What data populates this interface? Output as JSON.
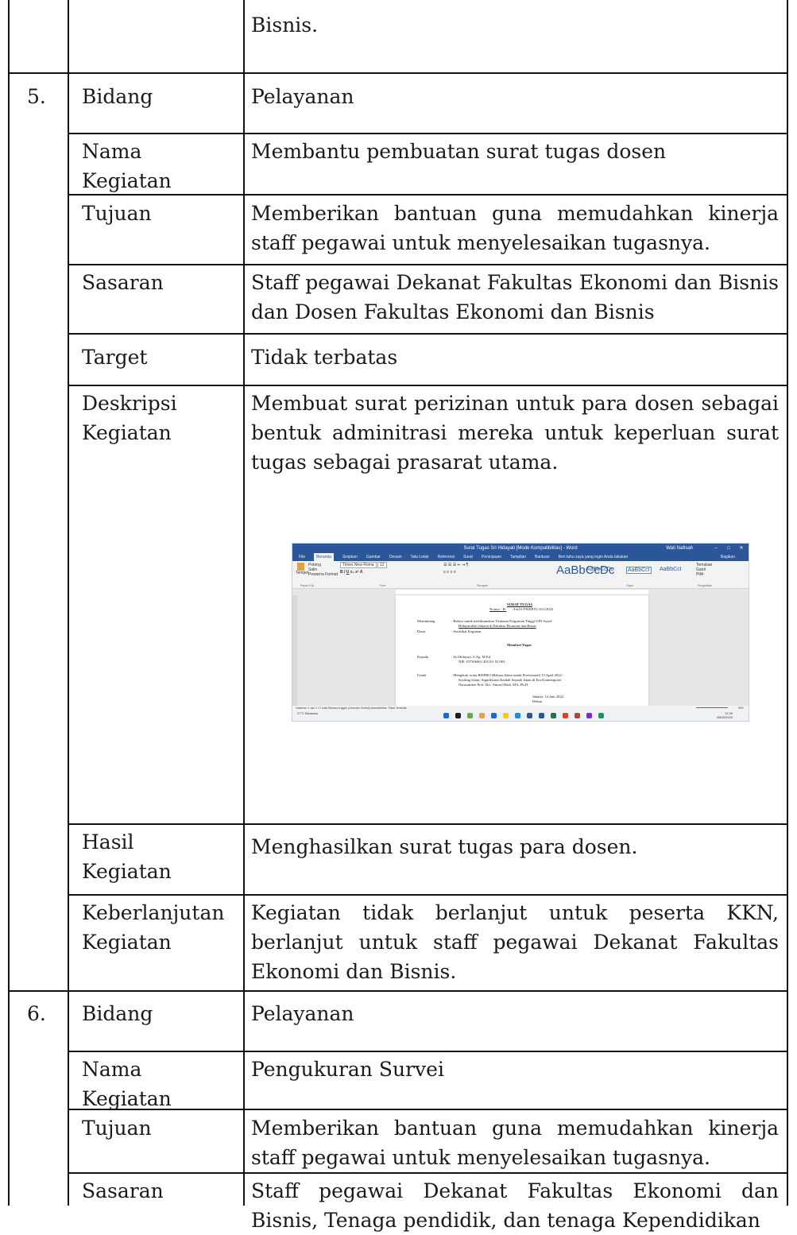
{
  "top_row": {
    "continuation": "Bisnis."
  },
  "section5": {
    "number": "5.",
    "rows": [
      {
        "label": "Bidang",
        "value": "Pelayanan"
      },
      {
        "label": "Nama Kegiatan",
        "value": "Membantu pembuatan surat tugas dosen"
      },
      {
        "label": "Tujuan",
        "value": "Memberikan bantuan guna memudahkan kinerja staff pegawai untuk menyelesaikan tugasnya."
      },
      {
        "label": "Sasaran",
        "value": "Staff pegawai Dekanat Fakultas Ekonomi dan Bisnis dan Dosen Fakultas Ekonomi dan Bisnis"
      },
      {
        "label": "Target",
        "value": "Tidak terbatas"
      },
      {
        "label": "Deskripsi Kegiatan",
        "value": "Membuat surat perizinan untuk para dosen sebagai bentuk adminitrasi mereka untuk keperluan surat tugas sebagai prasarat utama."
      },
      {
        "label": "Hasil Kegiatan",
        "value": "Menghasilkan surat tugas para dosen."
      },
      {
        "label": "Keberlanjutan Kegiatan",
        "value": "Kegiatan tidak berlanjut untuk peserta KKN, berlanjut untuk staff pegawai Dekanat Fakultas Ekonomi dan Bisnis."
      }
    ]
  },
  "section6": {
    "number": "6.",
    "rows": [
      {
        "label": "Bidang",
        "value": "Pelayanan"
      },
      {
        "label": "Nama Kegiatan",
        "value": "Pengukuran Survei"
      },
      {
        "label": "Tujuan",
        "value": "Memberikan bantuan guna memudahkan kinerja staff pegawai untuk menyelesaikan tugasnya."
      },
      {
        "label": "Sasaran",
        "value": "Staff pegawai Dekanat Fakultas Ekonomi dan Bisnis, Tenaga pendidik, dan tenaga Kependidikan"
      }
    ]
  },
  "screenshot": {
    "window_title": "Surat Tugas Sri Hidayati [Mode Kompatibilitas] - Word",
    "user_name": "Wati Nafisah",
    "menu_tabs": [
      "File",
      "Beranda",
      "Sisipkan",
      "Gambar",
      "Desain",
      "Tata Letak",
      "Referensi",
      "Surat",
      "Peninjauan",
      "Tampilan",
      "Bantuan"
    ],
    "tell_me": "Beri tahu saya yang ingin Anda lakukan",
    "share": "Bagikan",
    "font_name": "Times New Roma",
    "font_size": "12",
    "paste_label": "Tempel",
    "clipboard_items": [
      "Potong",
      "Salin",
      "Pewarna Format"
    ],
    "group_labels": [
      "Papan Klip",
      "Font",
      "Paragraf",
      "Gaya",
      "Pengeditan"
    ],
    "styles": [
      "AaBbCcDc",
      "AaBbCcDc",
      "AaBbCcI",
      "AaBbCcI"
    ],
    "style_names": [
      "Judul",
      "Judul 1",
      "Bezt",
      "Normal",
      "Penekanan"
    ],
    "editing": [
      "Temukan",
      "Ganti",
      "Pilih"
    ],
    "doc": {
      "heading": "SURAT TUGAS",
      "nomor_label": "Nomor : B-",
      "nomor_rest": "/Un.01/F8/KP.01.3/",
      "nomor_red": "06",
      "nomor_year": "/2022",
      "menimbang_label": "Menimbang",
      "menimbang_1": ":   Bahwa untuk melaksanakan Tridarma Perguruan Tinggi UIN Syarif",
      "menimbang_2": "Hidayatullah Jakarta di Fakultas Ekonomi dan Bisnis",
      "dasar_label": "Dasar",
      "dasar_text": ":   Sertifikat Kegiatan",
      "memberi": "Memberi Tugas",
      "kepada_label": "Kepada",
      "kepada_1": ":   Sri Hidayati, S.Ag. M.Ed.",
      "kepada_2": "NIP. 197306062 201101 02 003",
      "untuk_label": "Untuk",
      "untuk_1": ":   Mengikuti acara BISPRO (Bahasa Islam untuk Profesional) 15 April 2022 -",
      "untuk_2": "Sosiling Islam: Signifikansi Kaidah Sejarah Islam di Era Kontemporer",
      "untuk_3": "Narasumber Prof. Drs. Amirul Hadi, MA, Ph.D.",
      "place_date": "Jakarta,    14 Juni 2022",
      "dekan": "Dekan"
    },
    "status_left": "Halaman 1 dari 1    27 kata    Bahasa Inggris (Amerika Serikat)    Aksesibilitas: Tidak Tersedia",
    "zoom": "55%",
    "weather": "27°C Berawan",
    "clock_time": "12.39",
    "clock_date": "05/09/2022",
    "icon_colors": [
      "#1e66d0",
      "#1e1e1e",
      "#6aa84f",
      "#e8a33d",
      "#1e66d0",
      "#ffcc00",
      "#1e88e5",
      "#2b579a",
      "#2b579a",
      "#217346",
      "#d24726",
      "#b7472a",
      "#7b2bd2",
      "#0f9d58"
    ]
  }
}
